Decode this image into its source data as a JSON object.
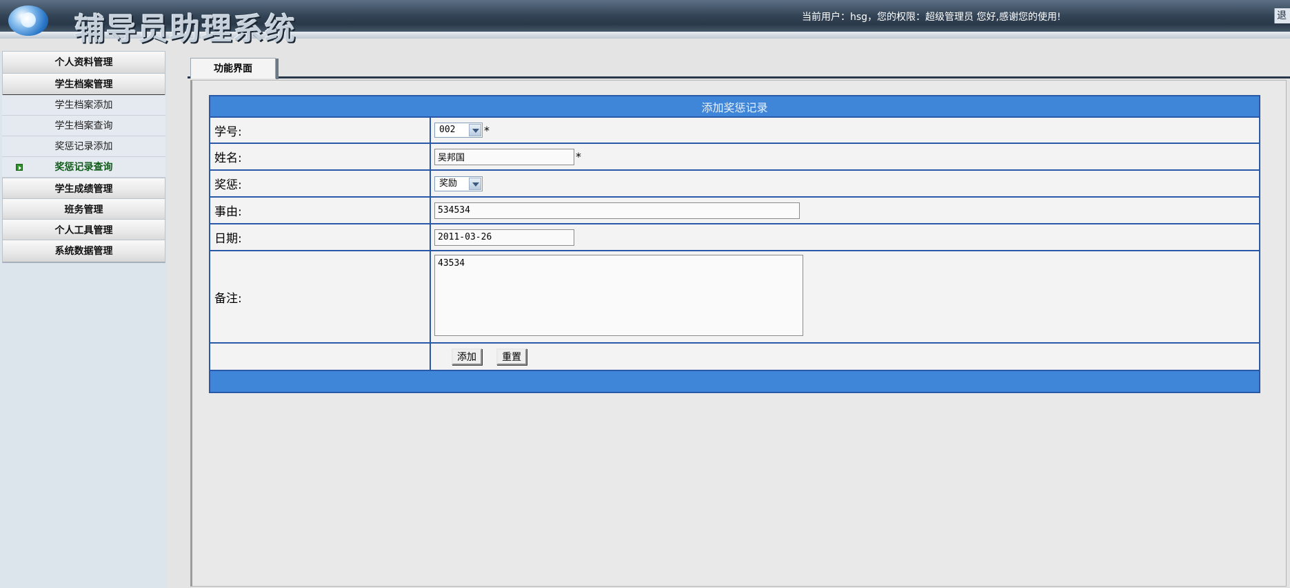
{
  "header": {
    "title": "辅导员助理系统",
    "user_info": "当前用户：hsg，您的权限：超级管理员  您好,感谢您的使用!",
    "logout_label": "退"
  },
  "sidebar": {
    "menus": [
      {
        "label": "个人资料管理"
      },
      {
        "label": "学生档案管理"
      },
      {
        "label": "学生成绩管理"
      },
      {
        "label": "班务管理"
      },
      {
        "label": "个人工具管理"
      },
      {
        "label": "系统数据管理"
      }
    ],
    "sub_items": [
      {
        "label": "学生档案添加"
      },
      {
        "label": "学生档案查询"
      },
      {
        "label": "奖惩记录添加"
      },
      {
        "label": "奖惩记录查询"
      }
    ]
  },
  "tabs": {
    "active": "功能界面"
  },
  "form": {
    "title": "添加奖惩记录",
    "fields": {
      "student_id": {
        "label": "学号:",
        "value": "002",
        "required": "*"
      },
      "name": {
        "label": "姓名:",
        "value": "吴邦国",
        "required": "*"
      },
      "reward_punish": {
        "label": "奖惩:",
        "value": "奖励"
      },
      "reason": {
        "label": "事由:",
        "value": "534534"
      },
      "date": {
        "label": "日期:",
        "value": "2011-03-26"
      },
      "remark": {
        "label": "备注:",
        "value": "43534"
      }
    },
    "buttons": {
      "add": "添加",
      "reset": "重置"
    }
  }
}
